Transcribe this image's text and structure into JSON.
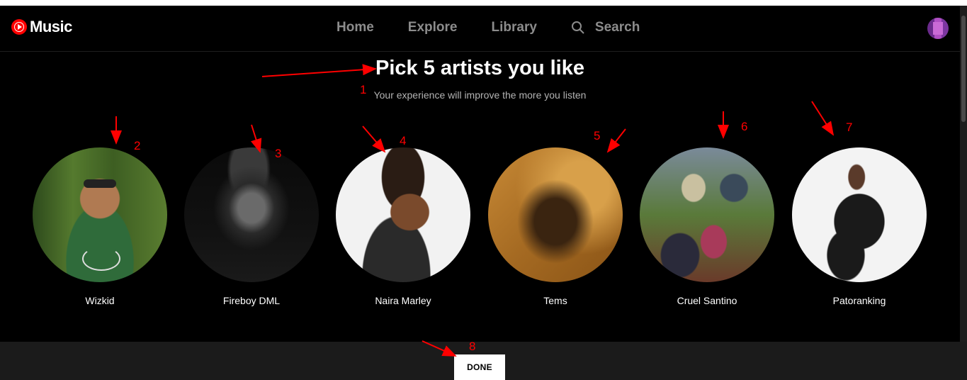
{
  "header": {
    "logo_text": "Music",
    "nav": [
      "Home",
      "Explore",
      "Library"
    ],
    "search_label": "Search"
  },
  "main": {
    "title": "Pick 5 artists you like",
    "subtitle": "Your experience will improve the more you listen"
  },
  "artists": [
    {
      "name": "Wizkid"
    },
    {
      "name": "Fireboy DML"
    },
    {
      "name": "Naira Marley"
    },
    {
      "name": "Tems"
    },
    {
      "name": "Cruel Santino"
    },
    {
      "name": "Patoranking"
    }
  ],
  "footer": {
    "done_label": "DONE"
  },
  "annotations": [
    "1",
    "2",
    "3",
    "4",
    "5",
    "6",
    "7",
    "8"
  ],
  "colors": {
    "background": "#000000",
    "accent": "#ff0000",
    "annotation": "#ff0000",
    "footer": "#1b1b1b"
  }
}
